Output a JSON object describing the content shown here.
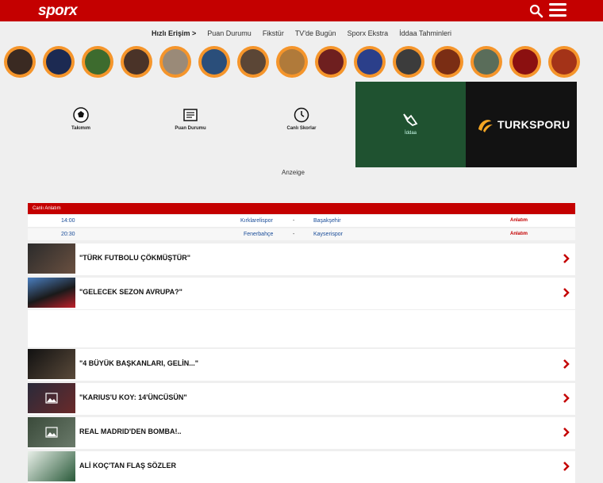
{
  "header": {
    "logo_text": "sporx"
  },
  "quicknav": {
    "label": "Hızlı Erişim >",
    "items": [
      "Puan Durumu",
      "Fikstür",
      "TV'de Bugün",
      "Sporx Ekstra",
      "İddaa Tahminleri"
    ]
  },
  "tiles": {
    "team": "Takımım",
    "standings": "Puan Durumu",
    "live_scores": "Canlı Skorlar"
  },
  "promos": {
    "iddaa_label": "İddaa",
    "turksporu": "TURKSPORU"
  },
  "ad_label": "Anzeige",
  "live": {
    "heading": "Canlı Anlatım",
    "matches": [
      {
        "time": "14:00",
        "home": "Kırklarelispor",
        "sep": "-",
        "away": "Başakşehir",
        "link": "Anlatım"
      },
      {
        "time": "20:30",
        "home": "Fenerbahçe",
        "sep": "-",
        "away": "Kayserispor",
        "link": "Anlatım"
      }
    ]
  },
  "news": [
    {
      "title": "\"TÜRK FUTBOLU ÇÖKMÜŞTÜR\""
    },
    {
      "title": "\"GELECEK SEZON AVRUPA?\""
    },
    {
      "title": "\"4 BÜYÜK BAŞKANLARI, GELİN...\""
    },
    {
      "title": "\"KARIUS'U KOY: 14'ÜNCÜSÜN\""
    },
    {
      "title": "REAL MADRID'DEN BOMBA!.."
    },
    {
      "title": "ALİ KOÇ'TAN FLAŞ SÖZLER"
    }
  ],
  "colors": {
    "brand": "#c40000",
    "accent": "#f5952b",
    "link": "#1a4d99"
  }
}
